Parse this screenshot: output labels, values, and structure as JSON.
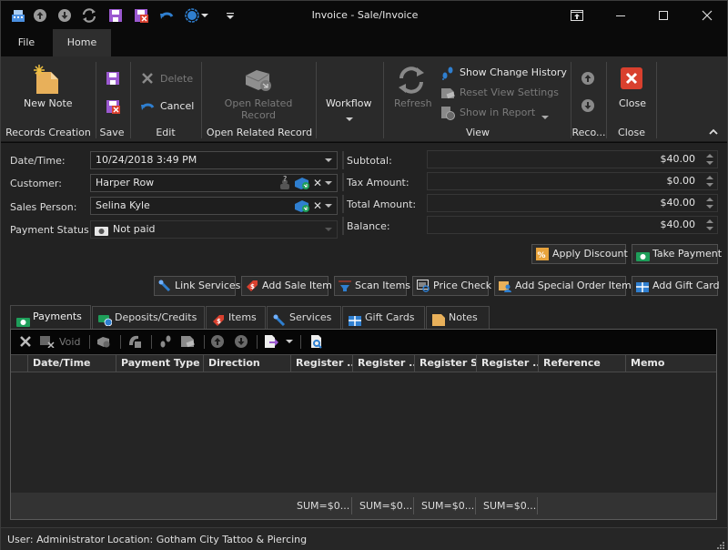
{
  "window": {
    "title": "Invoice  - Sale/Invoice",
    "quick_access": [
      "register-icon",
      "arrow-up-icon",
      "arrow-down-icon",
      "refresh-icon",
      "save-icon",
      "save-close-icon",
      "undo-icon",
      "record-icon",
      "customize-icon"
    ],
    "controls": [
      "restore-ribbon",
      "minimize",
      "maximize",
      "close"
    ]
  },
  "menu": {
    "tabs": [
      {
        "label": "File",
        "active": false
      },
      {
        "label": "Home",
        "active": true
      }
    ]
  },
  "ribbon": {
    "groups": [
      {
        "label": "Records Creation",
        "buttons": [
          {
            "label": "New Note",
            "icon": "new-note-icon",
            "enabled": true
          }
        ]
      },
      {
        "label": "Save",
        "buttons": [
          {
            "label": "",
            "icon": "save-icon",
            "enabled": true
          },
          {
            "label": "",
            "icon": "save-close-icon",
            "enabled": true
          }
        ]
      },
      {
        "label": "Edit",
        "buttons": [
          {
            "label": "Delete",
            "icon": "delete-icon",
            "enabled": false
          },
          {
            "label": "Cancel",
            "icon": "undo-icon",
            "enabled": true
          }
        ]
      },
      {
        "label": "Open Related Record",
        "buttons": [
          {
            "label": "Open Related Record",
            "line1": "Open Related",
            "line2": "Record",
            "icon": "open-related-icon",
            "enabled": false
          }
        ]
      },
      {
        "label": "",
        "buttons": [
          {
            "label": "Workflow",
            "icon": "dropdown-icon",
            "enabled": true
          }
        ]
      },
      {
        "label": "View",
        "buttons": [
          {
            "label": "Refresh",
            "icon": "refresh-icon",
            "enabled": false
          },
          {
            "label": "Show Change History",
            "icon": "footprints-icon",
            "enabled": true
          },
          {
            "label": "Reset View Settings",
            "icon": "reset-view-icon",
            "enabled": false
          },
          {
            "label": "Show in Report",
            "icon": "report-icon",
            "enabled": false
          }
        ]
      },
      {
        "label": "Reco...",
        "buttons": [
          {
            "label": "",
            "icon": "arrow-up-icon",
            "enabled": false
          },
          {
            "label": "",
            "icon": "arrow-down-icon",
            "enabled": false
          }
        ]
      },
      {
        "label": "Close",
        "buttons": [
          {
            "label": "Close",
            "icon": "close-red-icon",
            "enabled": true
          }
        ]
      }
    ]
  },
  "form": {
    "date_time": {
      "label": "Date/Time:",
      "value": "10/24/2018 3:49 PM"
    },
    "customer": {
      "label": "Customer:",
      "value": "Harper Row"
    },
    "sales_person": {
      "label": "Sales Person:",
      "value": "Selina Kyle"
    },
    "payment_status": {
      "label": "Payment Status:",
      "value": "Not paid"
    },
    "subtotal": {
      "label": "Subtotal:",
      "value": "$40.00"
    },
    "tax_amount": {
      "label": "Tax Amount:",
      "value": "$0.00"
    },
    "total_amount": {
      "label": "Total Amount:",
      "value": "$40.00"
    },
    "balance": {
      "label": "Balance:",
      "value": "$40.00"
    }
  },
  "actions": {
    "apply_discount": "Apply Discount",
    "take_payment": "Take Payment",
    "link_services": "Link Services",
    "add_sale_item": "Add Sale Item",
    "scan_items": "Scan Items",
    "price_check": "Price Check",
    "add_special_order_item": "Add Special Order Item",
    "add_gift_card": "Add Gift Card"
  },
  "detail_tabs": [
    {
      "label": "Payments",
      "icon": "cash-icon",
      "active": true
    },
    {
      "label": "Deposits/Credits",
      "icon": "deposit-icon",
      "active": false
    },
    {
      "label": "Items",
      "icon": "price-tag-icon",
      "active": false
    },
    {
      "label": "Services",
      "icon": "tools-icon",
      "active": false
    },
    {
      "label": "Gift Cards",
      "icon": "gift-icon",
      "active": false
    },
    {
      "label": "Notes",
      "icon": "note-icon",
      "active": false
    }
  ],
  "grid_toolbar": {
    "void_label": "Void"
  },
  "grid": {
    "columns": [
      "Date/Time",
      "Payment Type",
      "Direction",
      "Register ...",
      "Register ...",
      "Register S...",
      "Register ...",
      "Reference",
      "Memo"
    ],
    "rows": [],
    "footer_sums": [
      "SUM=$0...",
      "SUM=$0...",
      "SUM=$0...",
      "SUM=$0..."
    ]
  },
  "status": {
    "user": "User: Administrator",
    "location": "Location: Gotham City Tattoo & Piercing"
  },
  "colors": {
    "accent_blue": "#2f7fd0",
    "close_red": "#d9402e",
    "note_yellow": "#e8b05a",
    "save_purple": "#9b59d0",
    "cash_green": "#1e9e5a"
  }
}
